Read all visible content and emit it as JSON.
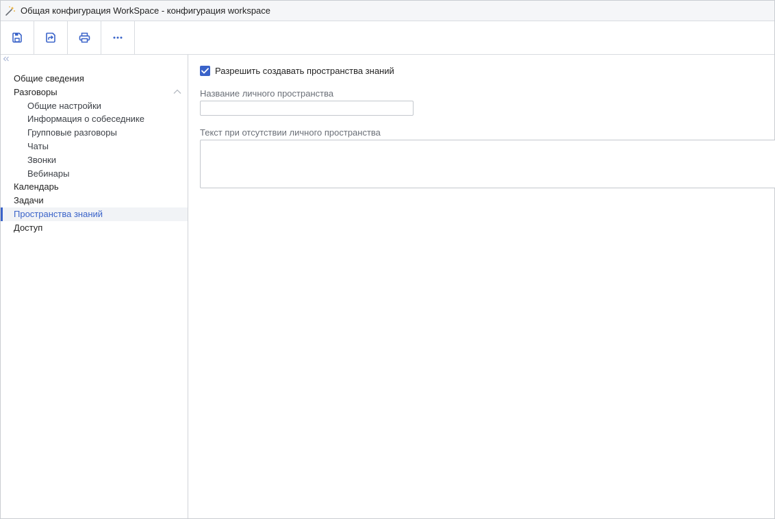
{
  "window": {
    "title": "Общая конфигурация WorkSpace - конфигурация workspace",
    "app_icon": "magic-wand-icon"
  },
  "toolbar": {
    "buttons": [
      {
        "name": "save-icon",
        "color": "#3a63c9"
      },
      {
        "name": "save-and-close-icon",
        "color": "#3a63c9"
      },
      {
        "name": "print-icon",
        "color": "#3a63c9"
      },
      {
        "name": "more-icon",
        "color": "#3a63c9"
      }
    ]
  },
  "sidebar": {
    "items": [
      {
        "label": "Общие сведения"
      },
      {
        "label": "Разговоры",
        "expanded": true
      },
      {
        "label": "Общие настройки"
      },
      {
        "label": "Информация о собеседнике"
      },
      {
        "label": "Групповые разговоры"
      },
      {
        "label": "Чаты"
      },
      {
        "label": "Звонки"
      },
      {
        "label": "Вебинары"
      },
      {
        "label": "Календарь"
      },
      {
        "label": "Задачи"
      },
      {
        "label": "Пространства знаний",
        "active": true
      },
      {
        "label": "Доступ"
      }
    ]
  },
  "form": {
    "allow_spaces": {
      "label": "Разрешить создавать пространства знаний",
      "checked": true
    },
    "personal_space_name": {
      "label": "Название личного пространства",
      "value": ""
    },
    "no_space_text": {
      "label": "Текст при отсутствии личного пространства",
      "value": ""
    }
  },
  "colors": {
    "accent": "#3a63c9",
    "border": "#d8dbe0",
    "active_bg": "#f1f3f6"
  }
}
